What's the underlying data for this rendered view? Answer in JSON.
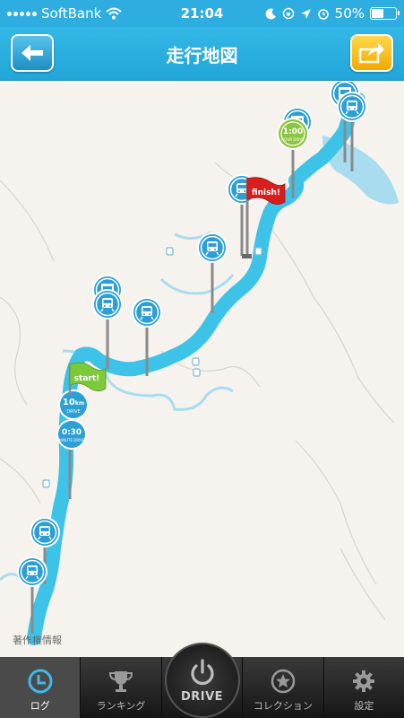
{
  "status": {
    "carrier": "SoftBank",
    "time": "21:04",
    "battery": "50%",
    "battery_level": 0.5
  },
  "nav": {
    "title": "走行地図",
    "back_icon": "arrow-left-icon",
    "share_icon": "share-arrow-icon"
  },
  "map": {
    "attribution": "著作権情報",
    "flags": {
      "start": "start!",
      "finish": "finish!"
    },
    "badges": {
      "distance_value": "10",
      "distance_unit": "km",
      "distance_label": "DRIVE",
      "time_value": "0:30",
      "time_label": "MINUTE DRIVE",
      "hour_value": "1:00",
      "hour_label": "HOUR DRIVE"
    },
    "colors": {
      "route": "#3ec3e8",
      "pin": "#2b9fd6",
      "start_flag": "#7cc93a",
      "finish_flag": "#d91e1e",
      "hour_badge": "#8cc63f"
    }
  },
  "tabs": [
    {
      "label": "ログ",
      "icon": "clock-icon",
      "active": true
    },
    {
      "label": "ランキング",
      "icon": "trophy-icon",
      "active": false
    },
    {
      "label": "DRIVE",
      "icon": "power-icon",
      "active": false
    },
    {
      "label": "コレクション",
      "icon": "star-medal-icon",
      "active": false
    },
    {
      "label": "設定",
      "icon": "gear-icon",
      "active": false
    }
  ]
}
